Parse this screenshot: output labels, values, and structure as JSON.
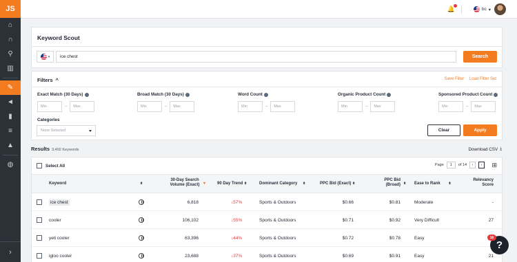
{
  "app": {
    "logo": "JS"
  },
  "sidebar": {
    "items": [
      {
        "name": "home-icon",
        "glyph": "⌂"
      },
      {
        "name": "headphones-icon",
        "glyph": "∩"
      },
      {
        "name": "search-icon",
        "glyph": "⚲"
      },
      {
        "name": "database-icon",
        "glyph": "▥"
      },
      {
        "name": "wrench-icon",
        "glyph": "✎",
        "active": true
      },
      {
        "name": "megaphone-icon",
        "glyph": "◄"
      },
      {
        "name": "analytics-icon",
        "glyph": "▮"
      },
      {
        "name": "academy-icon",
        "glyph": "≡"
      },
      {
        "name": "graduation-cap-icon",
        "glyph": "▲"
      },
      {
        "name": "globe-icon",
        "glyph": "◍"
      }
    ],
    "collapse_glyph": "›"
  },
  "topbar": {
    "locale": "bc",
    "locale_caret": "▾"
  },
  "keyword_scout": {
    "title": "Keyword Scout",
    "market_caret": "▾",
    "search_value": "ice chest",
    "search_button": "Search"
  },
  "filters": {
    "title": "Filters",
    "toggle_glyph": "^",
    "save_filter": "Save Filter",
    "load_filter_set": "Load Filter Set",
    "groups": [
      {
        "label": "Exact Match (30 Days)",
        "min": "Min",
        "max": "Max"
      },
      {
        "label": "Broad Match (30 Days)",
        "min": "Min",
        "max": "Max"
      },
      {
        "label": "Word Count",
        "min": "Min",
        "max": "Max"
      },
      {
        "label": "Organic Product Count",
        "min": "Min",
        "max": "Max"
      },
      {
        "label": "Sponsored Product Count",
        "min": "Min",
        "max": "Max"
      }
    ],
    "dash": "–",
    "categories_label": "Categories",
    "categories_value": "None Selected",
    "clear": "Clear",
    "apply": "Apply"
  },
  "results": {
    "label": "Results",
    "count": "3,492 Keywords",
    "download": "Download CSV",
    "download_glyph": "⤓",
    "select_all": "Select All",
    "page_label": "Page",
    "page_value": "1",
    "page_of": "of 14",
    "prev": "‹",
    "next": "›",
    "columns_glyph": "⊞"
  },
  "table": {
    "sort_glyph": "⬍",
    "sort_active_glyph": "▾",
    "headers": {
      "keyword": "Keyword",
      "volume_line1": "30-Day Search",
      "volume_line2": "Volume (Exact)",
      "trend": "90 Day Trend",
      "category": "Dominant Category",
      "ppc_exact": "PPC Bid (Exact)",
      "ppc_broad_line1": "PPC Bid",
      "ppc_broad_line2": "(Broad)",
      "ease": "Ease to Rank",
      "relevancy_line1": "Relevancy",
      "relevancy_line2": "Score"
    },
    "rows": [
      {
        "keyword": "ice chest",
        "volume": "6,818",
        "trend": "↓57%",
        "category": "Sports & Outdoors",
        "ppc_exact": "$0.66",
        "ppc_broad": "$0.81",
        "ease": "Moderate",
        "relevancy": "-"
      },
      {
        "keyword": "cooler",
        "volume": "106,102",
        "trend": "↓55%",
        "category": "Sports & Outdoors",
        "ppc_exact": "$0.71",
        "ppc_broad": "$0.92",
        "ease": "Very Difficult",
        "relevancy": "27"
      },
      {
        "keyword": "yeti cooler",
        "volume": "63,396",
        "trend": "↓44%",
        "category": "Sports & Outdoors",
        "ppc_exact": "$0.72",
        "ppc_broad": "$0.78",
        "ease": "Easy",
        "relevancy": ""
      },
      {
        "keyword": "igloo cooler",
        "volume": "23,688",
        "trend": "↓37%",
        "category": "Sports & Outdoors",
        "ppc_exact": "$0.69",
        "ppc_broad": "$0.91",
        "ease": "Easy",
        "relevancy": "21"
      }
    ]
  },
  "help": {
    "glyph": "?",
    "badge": "16"
  }
}
